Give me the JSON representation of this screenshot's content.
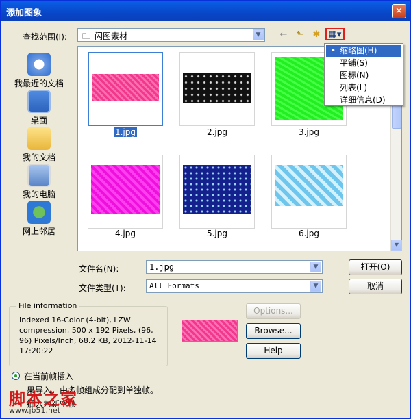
{
  "window": {
    "title": "添加图象",
    "close_glyph": "✕"
  },
  "look_in": {
    "label": "查找范围(I):",
    "value": "闪图素材",
    "arrow": "▼"
  },
  "toolbar": {
    "back_glyph": "←",
    "up_glyph": "⬑",
    "newfolder_glyph": "✱",
    "views_glyph": "▦▾"
  },
  "places": [
    {
      "label": "我最近的文档",
      "icon": "recent-docs-icon"
    },
    {
      "label": "桌面",
      "icon": "desktop-icon"
    },
    {
      "label": "我的文档",
      "icon": "my-documents-icon"
    },
    {
      "label": "我的电脑",
      "icon": "my-computer-icon"
    },
    {
      "label": "网上邻居",
      "icon": "network-icon"
    }
  ],
  "files": [
    {
      "name": "1.jpg",
      "selected": true,
      "color": "#f0388c"
    },
    {
      "name": "2.jpg",
      "selected": false,
      "color": "#111111"
    },
    {
      "name": "3.jpg",
      "selected": false,
      "color": "#22ee22"
    },
    {
      "name": "4.jpg",
      "selected": false,
      "color": "#ee11dd"
    },
    {
      "name": "5.jpg",
      "selected": false,
      "color": "#14208c"
    },
    {
      "name": "6.jpg",
      "selected": false,
      "color": "#6ec6ec"
    }
  ],
  "view_menu": {
    "items": [
      {
        "label": "缩略图(H)",
        "selected": true,
        "bullet": "•"
      },
      {
        "label": "平铺(S)",
        "selected": false,
        "bullet": ""
      },
      {
        "label": "图标(N)",
        "selected": false,
        "bullet": ""
      },
      {
        "label": "列表(L)",
        "selected": false,
        "bullet": ""
      },
      {
        "label": "详细信息(D)",
        "selected": false,
        "bullet": ""
      }
    ]
  },
  "filename": {
    "label": "文件名(N):",
    "value": "1.jpg",
    "arrow": "▼"
  },
  "filetype": {
    "label": "文件类型(T):",
    "value": "All Formats",
    "arrow": "▼"
  },
  "buttons": {
    "open": "打开(O)",
    "cancel": "取消",
    "options": "Options...",
    "browse": "Browse...",
    "help": "Help"
  },
  "file_info": {
    "title": "File information",
    "text": "Indexed 16-Color (4-bit), LZW compression, 500 x 192 Pixels, (96, 96) Pixels/Inch, 68.2 KB, 2012-11-14 17:20:22"
  },
  "insert": {
    "current_frame": "在当前帧插入",
    "split_partial": "果导入，由多帧组成分配到单独帧。",
    "new_frame_partial": "插入为新空帧"
  },
  "watermark": {
    "brand": "脚本之家",
    "url": "www.jb51.net"
  },
  "colors": {
    "selection": "#316ac5",
    "titlebar": "#0a5fe6"
  }
}
